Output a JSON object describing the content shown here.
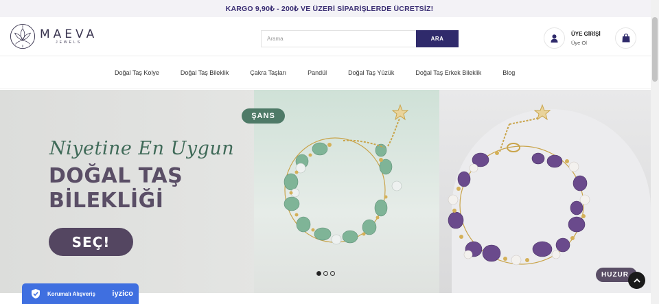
{
  "announcement": {
    "text": "KARGO 9,90₺ - 200₺ VE ÜZERİ SİPARİŞLERDE ÜCRETSİZ!"
  },
  "logo": {
    "name": "MAEVA",
    "sub": "JEWELS",
    "icon": "lotus-logo-icon"
  },
  "search": {
    "placeholder": "Arama",
    "button_label": "ARA"
  },
  "account": {
    "title": "ÜYE GİRİŞİ",
    "subtitle": "Üye Ol",
    "icon": "user-icon"
  },
  "cart": {
    "icon": "shopping-bag-icon"
  },
  "nav": {
    "items": [
      {
        "label": "Doğal Taş Kolye"
      },
      {
        "label": "Doğal Taş Bileklik"
      },
      {
        "label": "Çakra Taşları"
      },
      {
        "label": "Pandül"
      },
      {
        "label": "Doğal Taş Yüzük"
      },
      {
        "label": "Doğal Taş Erkek Bileklik"
      },
      {
        "label": "Blog"
      }
    ]
  },
  "hero": {
    "script_text": "Niyetine En Uygun",
    "headline_line1": "DOĞAL TAŞ",
    "headline_line2": "BİLEKLİĞİ",
    "cta_label": "SEÇ!",
    "tag_left": "ŞANS",
    "tag_right": "HUZUR",
    "slides": {
      "count": 3,
      "active": 1
    }
  },
  "trust_badge": {
    "label": "Korumalı Alışveriş",
    "brand": "iyzico"
  },
  "colors": {
    "brand_purple": "#2f2a6b",
    "announcement_text": "#3b2f74",
    "headline": "#5a4e66",
    "script_green": "#3f6a58",
    "tag_green": "#4e7a67",
    "trust_blue": "#3f6fe0"
  }
}
